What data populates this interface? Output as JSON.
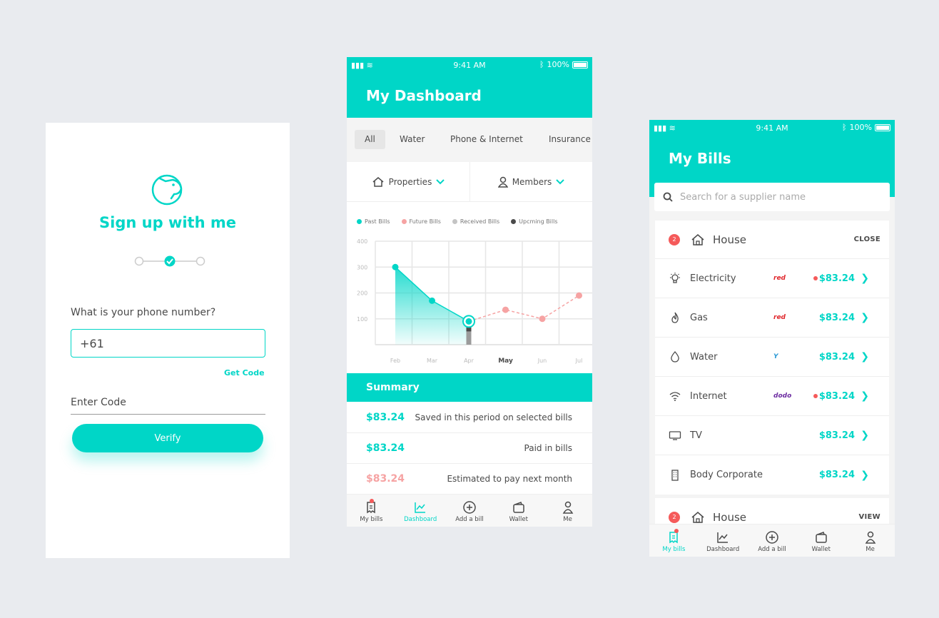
{
  "colors": {
    "accent": "#00d6c7",
    "alert": "#f55a5a",
    "future": "#f6a3a3"
  },
  "signup": {
    "title": "Sign up with me",
    "question": "What is your phone number?",
    "phone_value": "+61",
    "get_code": "Get Code",
    "code_placeholder": "Enter Code",
    "verify": "Verify",
    "steps": 3,
    "current_step": 2
  },
  "status": {
    "time": "9:41 AM",
    "battery": "100%"
  },
  "dashboard": {
    "title": "My Dashboard",
    "tabs": [
      "All",
      "Water",
      "Phone & Internet",
      "Insurance"
    ],
    "selected_tab": "All",
    "properties_label": "Properties",
    "members_label": "Members",
    "legend": [
      "Past Bills",
      "Future Bills",
      "Received Bills",
      "Upcming Bills"
    ],
    "summary_title": "Summary",
    "summary_rows": [
      {
        "amount": "$83.24",
        "desc": "Saved in this period on selected bills"
      },
      {
        "amount": "$83.24",
        "desc": "Paid in bills"
      },
      {
        "amount": "$83.24",
        "desc": "Estimated to pay next month"
      }
    ]
  },
  "chart_data": {
    "type": "area",
    "categories": [
      "Feb",
      "Mar",
      "Apr",
      "May",
      "Jun",
      "Jul"
    ],
    "highlight_category": "May",
    "ylim": [
      0,
      400
    ],
    "yticks": [
      100,
      200,
      300,
      400
    ],
    "series": [
      {
        "name": "Past Bills",
        "x": [
          "Feb",
          "Mar",
          "Apr"
        ],
        "values": [
          300,
          170,
          90
        ],
        "color": "#00d6c7"
      },
      {
        "name": "Future Bills",
        "x": [
          "Apr",
          "May",
          "Jun",
          "Jul"
        ],
        "values": [
          90,
          135,
          100,
          190
        ],
        "color": "#f6a3a3"
      }
    ],
    "legend_colors": [
      "#00d6c7",
      "#f6a3a3",
      "#c4c4c4",
      "#4a4a4a"
    ],
    "grid": true
  },
  "bills": {
    "title": "My Bills",
    "search_placeholder": "Search for a supplier name",
    "groups": [
      {
        "badge": "2",
        "name": "House",
        "action": "CLOSE"
      },
      {
        "badge": "2",
        "name": "House",
        "action": "VIEW"
      }
    ],
    "items": [
      {
        "name": "Electricity",
        "brand": "red",
        "price": "$83.24",
        "alert": true,
        "icon": "bulb-icon"
      },
      {
        "name": "Gas",
        "brand": "red",
        "price": "$83.24",
        "alert": false,
        "icon": "flame-icon"
      },
      {
        "name": "Water",
        "brand": "Y",
        "price": "$83.24",
        "alert": false,
        "icon": "drop-icon"
      },
      {
        "name": "Internet",
        "brand": "dodo",
        "price": "$83.24",
        "alert": true,
        "icon": "wifi-icon"
      },
      {
        "name": "TV",
        "brand": "",
        "price": "$83.24",
        "alert": false,
        "icon": "tv-icon"
      },
      {
        "name": "Body Corporate",
        "brand": "",
        "price": "$83.24",
        "alert": false,
        "icon": "building-icon"
      }
    ]
  },
  "tabbar": [
    "My bills",
    "Dashboard",
    "Add a bill",
    "Wallet",
    "Me"
  ]
}
